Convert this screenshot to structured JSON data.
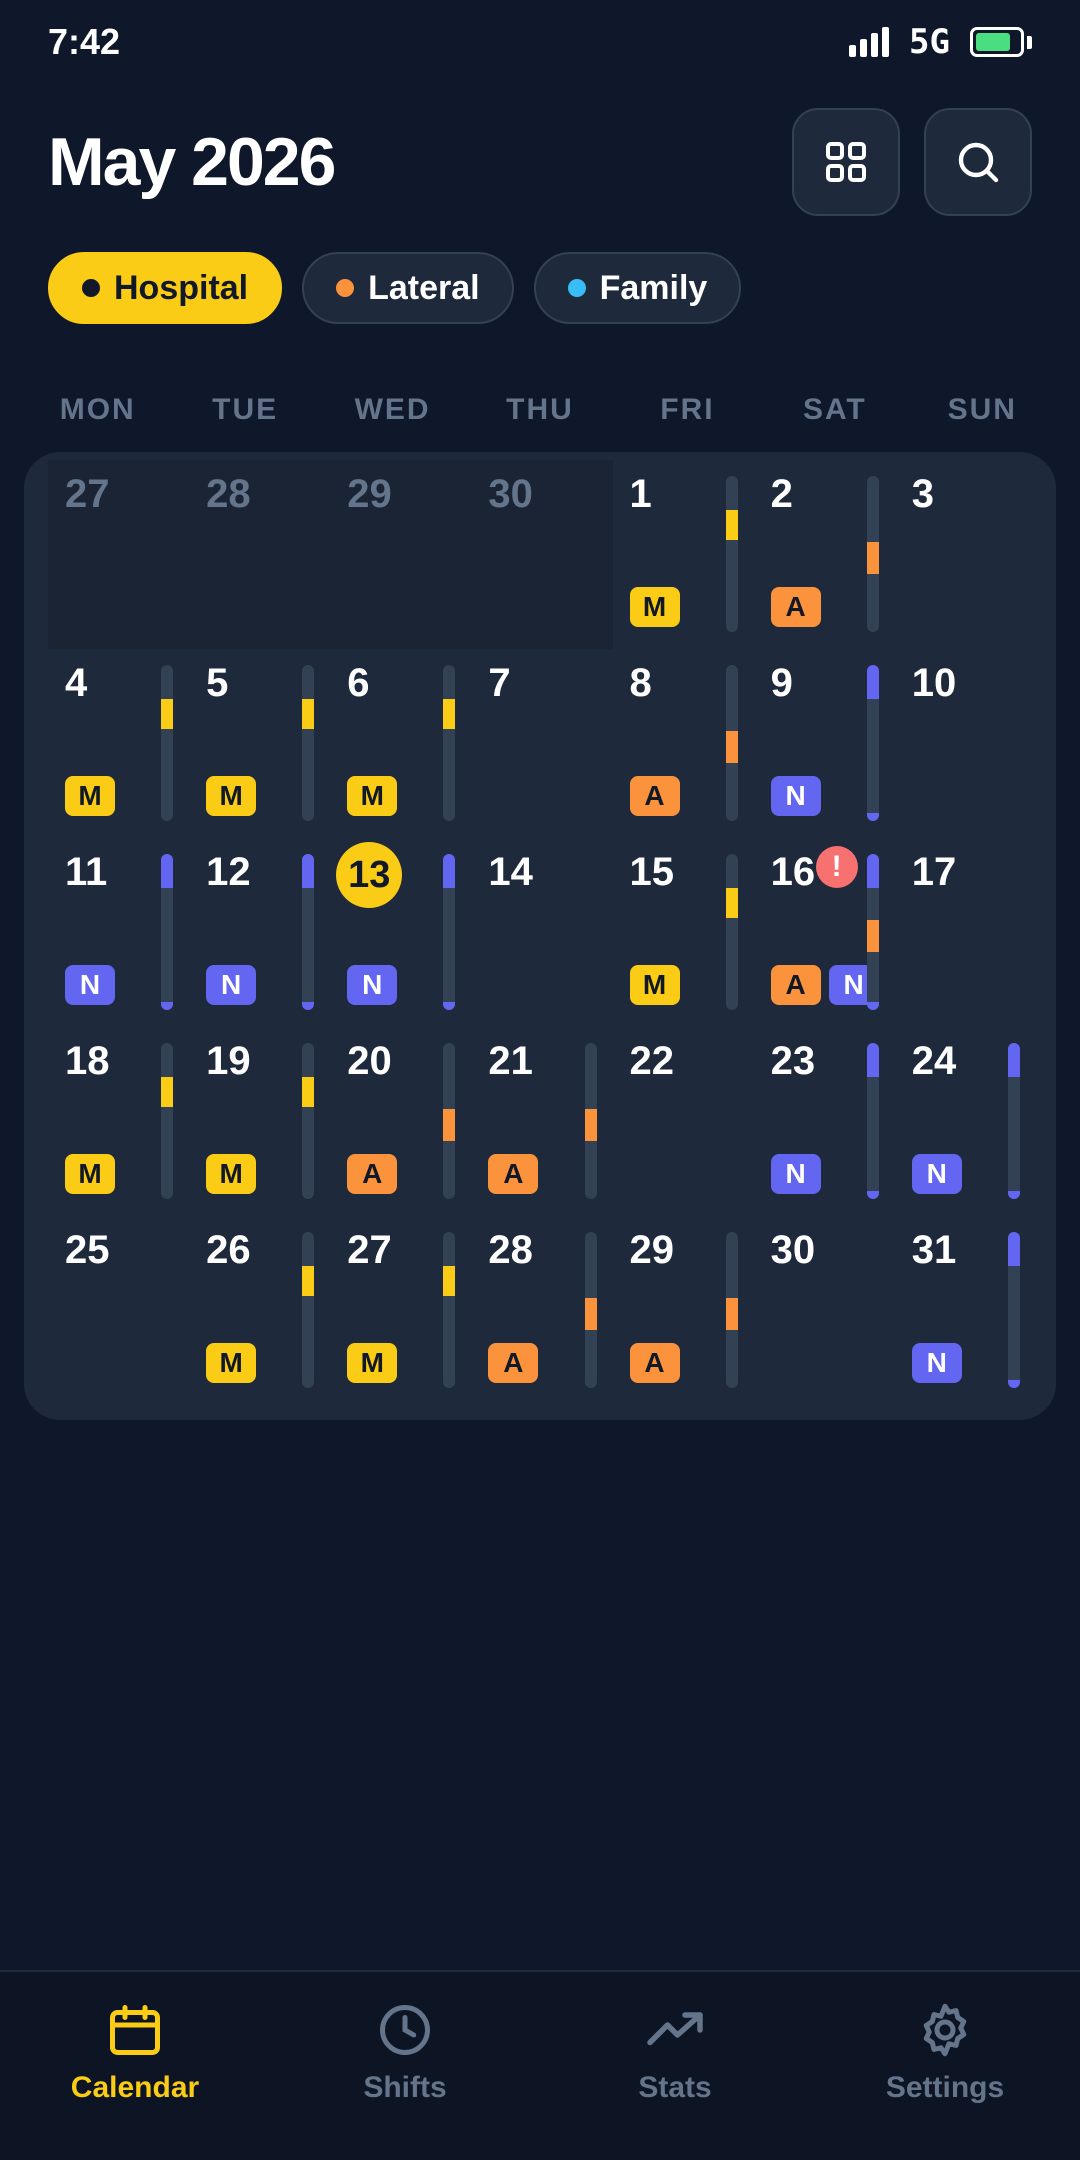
{
  "status": {
    "time": "7:42",
    "network": "5G",
    "battery_level": 0.8
  },
  "header": {
    "title": "May 2026",
    "grid_icon": "grid-view-icon",
    "search_icon": "search-icon"
  },
  "filters": [
    {
      "label": "Hospital",
      "dot_color": "#111827",
      "active": true
    },
    {
      "label": "Lateral",
      "dot_color": "#fb923c",
      "active": false
    },
    {
      "label": "Family",
      "dot_color": "#38bdf8",
      "active": false
    }
  ],
  "weekdays": [
    "MON",
    "TUE",
    "WED",
    "THU",
    "FRI",
    "SAT",
    "SUN"
  ],
  "shift_colors": {
    "M": "#facc15",
    "A": "#fb923c",
    "N": "#6366f1"
  },
  "today": "13",
  "days": [
    {
      "day": "27",
      "other_month": true,
      "shifts": []
    },
    {
      "day": "28",
      "other_month": true,
      "shifts": []
    },
    {
      "day": "29",
      "other_month": true,
      "shifts": []
    },
    {
      "day": "30",
      "other_month": true,
      "shifts": []
    },
    {
      "day": "1",
      "shifts": [
        "M"
      ]
    },
    {
      "day": "2",
      "shifts": [
        "A"
      ]
    },
    {
      "day": "3",
      "shifts": []
    },
    {
      "day": "4",
      "shifts": [
        "M"
      ]
    },
    {
      "day": "5",
      "shifts": [
        "M"
      ]
    },
    {
      "day": "6",
      "shifts": [
        "M"
      ]
    },
    {
      "day": "7",
      "shifts": []
    },
    {
      "day": "8",
      "shifts": [
        "A"
      ]
    },
    {
      "day": "9",
      "shifts": [
        "N"
      ]
    },
    {
      "day": "10",
      "shifts": []
    },
    {
      "day": "11",
      "shifts": [
        "N"
      ]
    },
    {
      "day": "12",
      "shifts": [
        "N"
      ]
    },
    {
      "day": "13",
      "shifts": [
        "N"
      ]
    },
    {
      "day": "14",
      "shifts": []
    },
    {
      "day": "15",
      "shifts": [
        "M"
      ]
    },
    {
      "day": "16",
      "shifts": [
        "A",
        "N"
      ],
      "alert": "!"
    },
    {
      "day": "17",
      "shifts": []
    },
    {
      "day": "18",
      "shifts": [
        "M"
      ]
    },
    {
      "day": "19",
      "shifts": [
        "M"
      ]
    },
    {
      "day": "20",
      "shifts": [
        "A"
      ]
    },
    {
      "day": "21",
      "shifts": [
        "A"
      ]
    },
    {
      "day": "22",
      "shifts": []
    },
    {
      "day": "23",
      "shifts": [
        "N"
      ]
    },
    {
      "day": "24",
      "shifts": [
        "N"
      ]
    },
    {
      "day": "25",
      "shifts": []
    },
    {
      "day": "26",
      "shifts": [
        "M"
      ]
    },
    {
      "day": "27",
      "shifts": [
        "M"
      ]
    },
    {
      "day": "28",
      "shifts": [
        "A"
      ]
    },
    {
      "day": "29",
      "shifts": [
        "A"
      ]
    },
    {
      "day": "30",
      "shifts": []
    },
    {
      "day": "31",
      "shifts": [
        "N"
      ]
    }
  ],
  "nav": [
    {
      "label": "Calendar",
      "icon": "calendar-icon",
      "active": true
    },
    {
      "label": "Shifts",
      "icon": "clock-icon",
      "active": false
    },
    {
      "label": "Stats",
      "icon": "trending-up-icon",
      "active": false
    },
    {
      "label": "Settings",
      "icon": "gear-icon",
      "active": false
    }
  ]
}
